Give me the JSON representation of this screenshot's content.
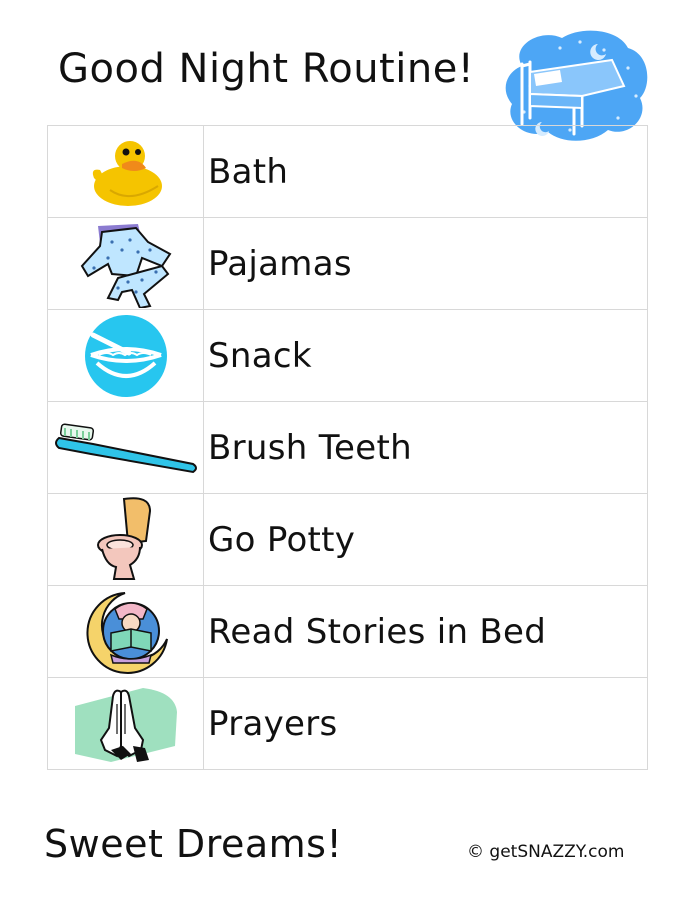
{
  "title": "Good Night Routine!",
  "header_icon": "bed-cloud-icon",
  "steps": [
    {
      "label": "Bath",
      "icon": "rubber-duck-icon"
    },
    {
      "label": "Pajamas",
      "icon": "pajamas-icon"
    },
    {
      "label": "Snack",
      "icon": "cereal-bowl-icon"
    },
    {
      "label": "Brush Teeth",
      "icon": "toothbrush-icon"
    },
    {
      "label": "Go Potty",
      "icon": "toilet-icon"
    },
    {
      "label": "Read Stories in Bed",
      "icon": "reading-moon-icon"
    },
    {
      "label": "Prayers",
      "icon": "praying-hands-icon"
    }
  ],
  "footer": {
    "closing": "Sweet Dreams!",
    "copyright": "© getSNAZZY.com"
  },
  "colors": {
    "cloud_blue": "#4da6f5",
    "table_border": "#d8d8d8",
    "duck_yellow": "#f5c400",
    "pajama_purple": "#8b7bd0",
    "bowl_cyan": "#27c6ef",
    "toilet_pink": "#f3c7bd",
    "hands_green": "#9fe0bf"
  }
}
